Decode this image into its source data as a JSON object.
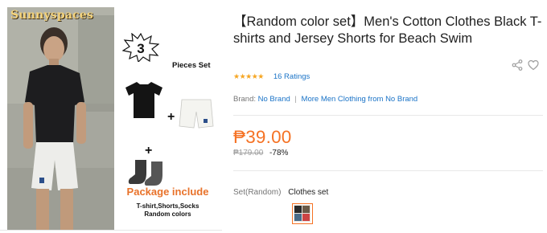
{
  "gallery": {
    "brand_watermark": "Sunnyspaces",
    "pieces_number": "3",
    "pieces_label": "Pieces Set",
    "package_title": "Package include",
    "package_items": "T-shirt,Shorts,Socks",
    "package_colors": "Random colors"
  },
  "product": {
    "title": "【Random color set】Men's Cotton Clothes Black T-shirts and Jersey Shorts for Beach Swim",
    "rating": {
      "stars": "★★★★★",
      "value": 5,
      "count_label": "16 Ratings"
    },
    "brand": {
      "label": "Brand:",
      "name": "No Brand",
      "more_link": "More Men Clothing from No Brand"
    },
    "price": {
      "current": "₱39.00",
      "original": "₱179.00",
      "discount": "-78%"
    },
    "option": {
      "label": "Set(Random)",
      "value": "Clothes set"
    }
  },
  "icons": {
    "share": "share-icon",
    "wishlist": "heart-icon"
  },
  "colors": {
    "price": "#f57224",
    "link": "#1a73c7",
    "star": "#f6a623",
    "watermark": "#f3d27a"
  }
}
